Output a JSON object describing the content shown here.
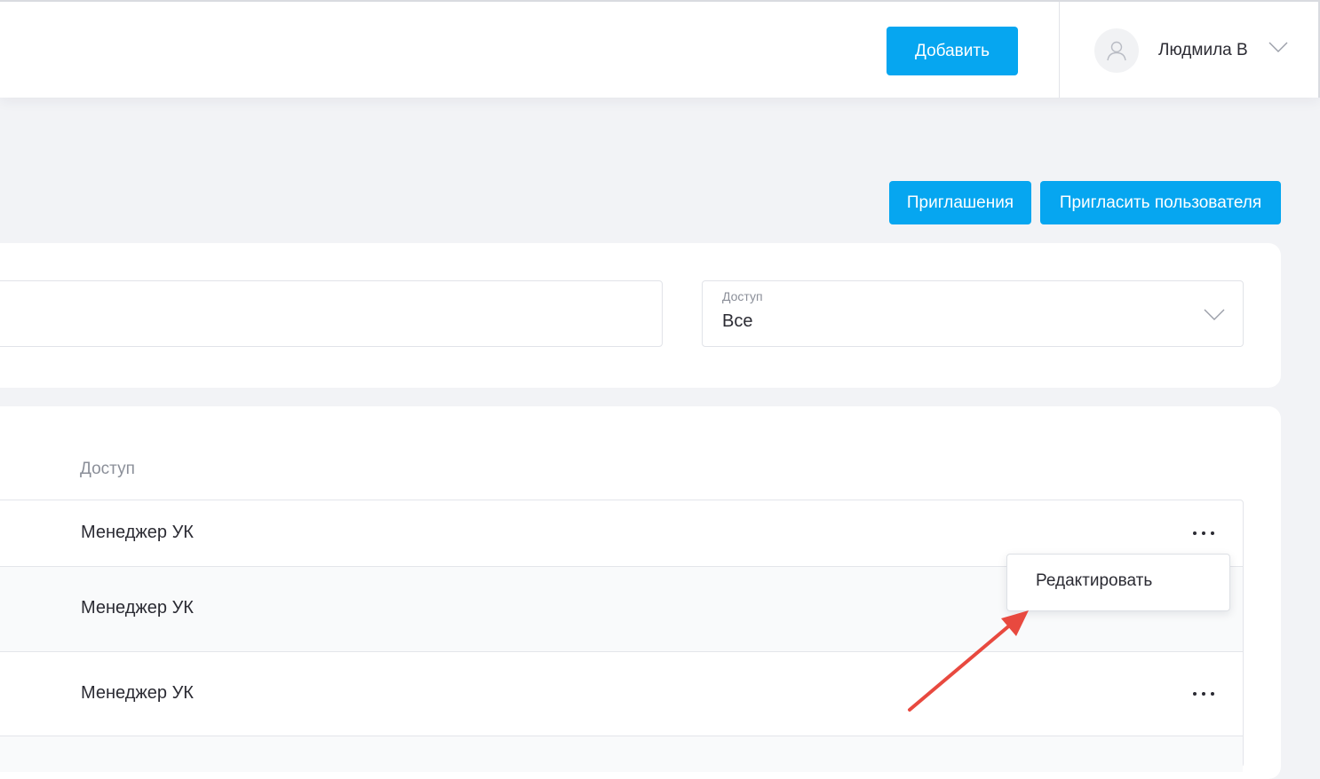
{
  "header": {
    "add_button_label": "Добавить",
    "user_name": "Людмила В"
  },
  "actions": {
    "invites_label": "Приглашения",
    "invite_user_label": "Пригласить пользователя"
  },
  "filters": {
    "search_value": "",
    "access": {
      "label": "Доступ",
      "value": "Все"
    }
  },
  "table": {
    "column_header": "Доступ",
    "rows": [
      {
        "access": "Менеджер УК"
      },
      {
        "access": "Менеджер УК"
      },
      {
        "access": "Менеджер УК"
      }
    ]
  },
  "context_menu": {
    "items": [
      {
        "label": "Редактировать"
      }
    ]
  },
  "colors": {
    "accent": "#06a6f0",
    "annotation": "#e8493f"
  },
  "icons": {
    "avatar": "user-avatar-icon",
    "dropdown": "chevron-down-icon",
    "row_menu": "more-horizontal-icon"
  }
}
